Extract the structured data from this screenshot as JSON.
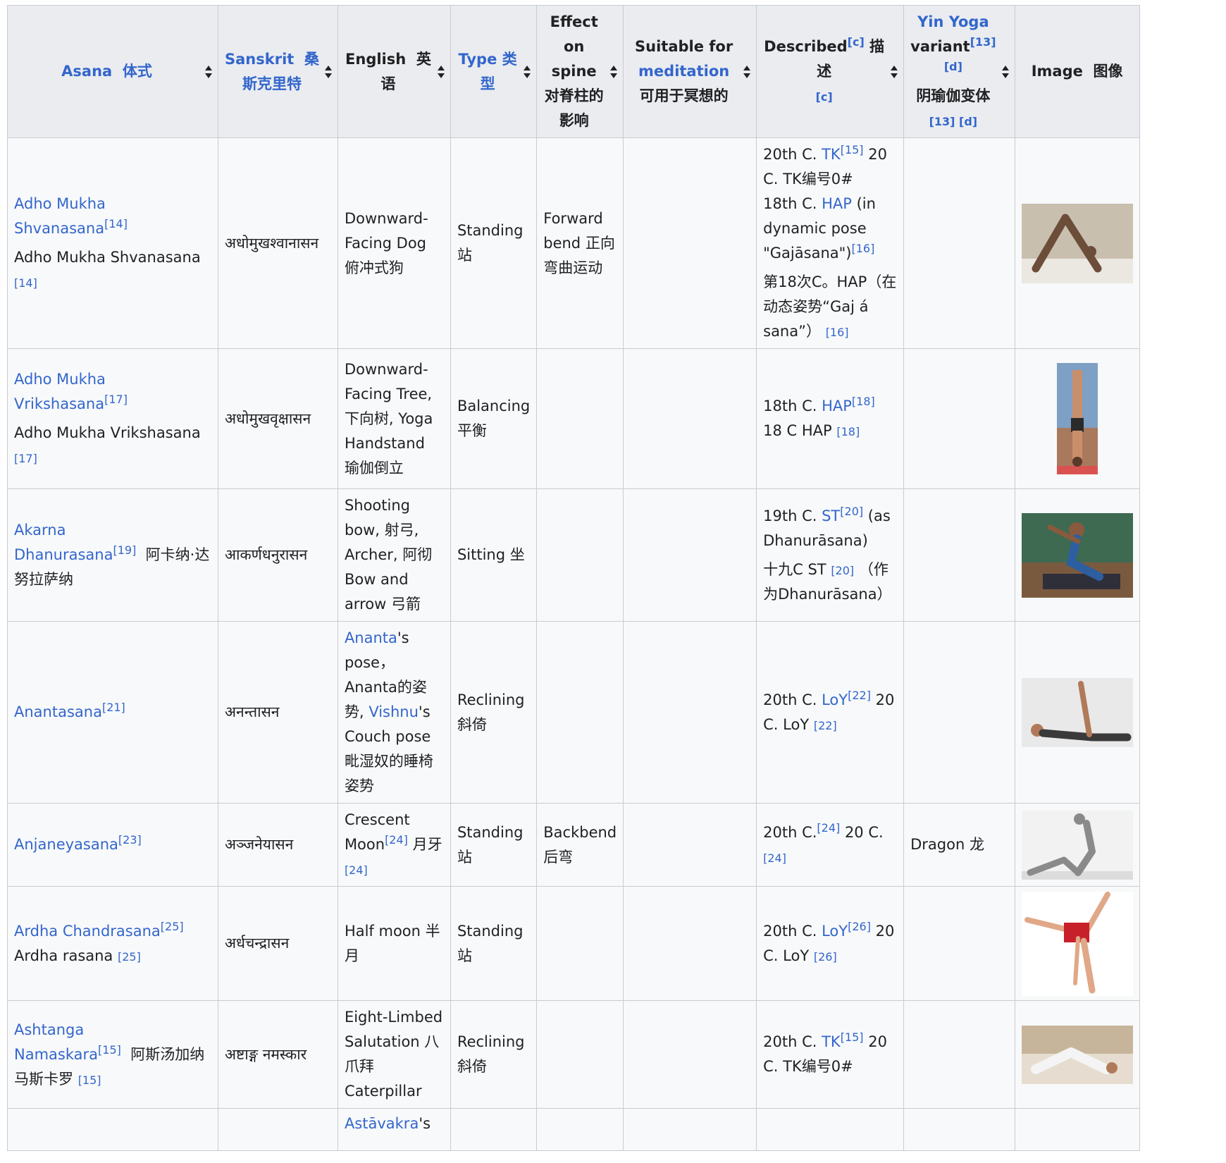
{
  "headers": [
    {
      "label": "Asana",
      "cn": "体式",
      "link": true
    },
    {
      "label": "Sanskrit",
      "cn": "桑斯克里特",
      "link": true
    },
    {
      "label": "English",
      "cn": "英语",
      "link": false
    },
    {
      "label": "Type",
      "cn": "类型",
      "link": true
    },
    {
      "label": "Effect on spine",
      "cn": "对脊柱的影响",
      "link": false
    },
    {
      "pre": "Suitable for",
      "link_text": "meditation",
      "cn": "可用于冥想的"
    },
    {
      "label": "Described",
      "sup": "[c]",
      "cn": "描述",
      "ref": "[c]"
    },
    {
      "link_text": "Yin Yoga",
      "post": "variant",
      "sup": "[13][d]",
      "cn": "阴瑜伽变体",
      "ref": "[13] [d]"
    },
    {
      "label": "Image",
      "cn": "图像"
    }
  ],
  "rows": [
    {
      "asana": {
        "link": "Adho Mukha Shvanasana",
        "sup": "[14]",
        "cn": "",
        "second": "Adho Mukha Shvanasana",
        "second_ref": "[14]"
      },
      "sanskrit": "अधोमुखश्वानासन",
      "english": "Downward-Facing Dog 俯冲式狗",
      "type": "Standing 站",
      "spine": "Forward bend 正向弯曲运动",
      "meditation": "",
      "described": {
        "p1_pre": "20th C.",
        "p1_link": "TK",
        "p1_sup": "[15]",
        "p1_post": "20 C. TK编号0#",
        "p2_pre": "18th C.",
        "p2_link": "HAP",
        "p2_post": "(in dynamic pose \"Gajāsana\")",
        "p2_sup": "[16]",
        "p3": "第18次C。HAP（在动态姿势“Gaj á sana”）",
        "p3_ref": "[16]"
      },
      "yin": "",
      "image": {
        "name": "downward-dog-photo",
        "w": 158,
        "h": 113,
        "bg": "#c9bfae"
      }
    },
    {
      "asana": {
        "link": "Adho Mukha Vrikshasana",
        "sup": "[17]",
        "cn": "",
        "second": "Adho Mukha Vrikshasana",
        "second_ref": "[17]"
      },
      "sanskrit": "अधोमुखवृक्षासन",
      "english": "Downward-Facing Tree, 下向树, Yoga Handstand 瑜伽倒立",
      "type": "Balancing 平衡",
      "spine": "",
      "meditation": "",
      "described": {
        "p1_pre": "18th C.",
        "p1_link": "HAP",
        "p1_sup": "[18]",
        "p1_post": "18 C HAP",
        "p1_ref": "[18]"
      },
      "yin": "",
      "image": {
        "name": "handstand-photo",
        "w": 58,
        "h": 158,
        "bg": "#a9795e"
      }
    },
    {
      "asana": {
        "link": "Akarna Dhanurasana",
        "sup": "[19]",
        "cn": "阿卡纳·达努拉萨纳"
      },
      "sanskrit": "आकर्णधनुरासन",
      "english": "Shooting bow, 射弓, Archer, 阿彻 Bow and arrow 弓箭",
      "type": "Sitting 坐",
      "spine": "",
      "meditation": "",
      "described": {
        "p1_pre": "19th C.",
        "p1_link": "ST",
        "p1_sup": "[20]",
        "p1_post": "(as Dhanurāsana)",
        "p3": "十九C ST",
        "p3_ref": "[20]",
        "p3_post": "（作为Dhanurāsana）"
      },
      "yin": "",
      "image": {
        "name": "archer-pose-photo",
        "w": 158,
        "h": 120,
        "bg": "#5b4a44"
      }
    },
    {
      "asana": {
        "link": "Anantasana",
        "sup": "[21]",
        "cn": ""
      },
      "sanskrit": "अनन्तासन",
      "english": {
        "link1": "Ananta",
        "t1": "'s pose，Ananta的姿势,",
        "link2": "Vishnu",
        "t2": "'s Couch pose 毗湿奴的睡椅姿势"
      },
      "type": "Reclining 斜倚",
      "spine": "",
      "meditation": "",
      "described": {
        "p1_pre": "20th C.",
        "p1_link": "LoY",
        "p1_sup": "[22]",
        "p1_post": "20 C. LoY",
        "p1_ref": "[22]"
      },
      "yin": "",
      "image": {
        "name": "anantasana-photo",
        "w": 158,
        "h": 98,
        "bg": "#e9e9e9"
      }
    },
    {
      "asana": {
        "link": "Anjaneyasana",
        "sup": "[23]",
        "cn": ""
      },
      "sanskrit": "अञ्जनेयासन",
      "english": {
        "text": "Crescent Moon",
        "sup": "[24]",
        "cn": "月牙",
        "ref": "[24]"
      },
      "type": "Standing 站",
      "spine": "Backbend 后弯",
      "meditation": "",
      "described": {
        "p1_pre": "20th C.",
        "p1_sup": "[24]",
        "p1_post": "20 C.",
        "p1_ref": "[24]"
      },
      "yin": "Dragon 龙",
      "image": {
        "name": "crescent-moon-illustration",
        "w": 158,
        "h": 98,
        "bg": "#dcdcdc"
      }
    },
    {
      "asana": {
        "link": "Ardha Chandrasana",
        "sup": "[25]",
        "cn": "",
        "second": "Ardha rasana",
        "second_ref": "[25]"
      },
      "sanskrit": "अर्धचन्द्रासन",
      "english": "Half moon 半月",
      "type": "Standing 站",
      "spine": "",
      "meditation": "",
      "described": {
        "p1_pre": "20th C.",
        "p1_link": "LoY",
        "p1_sup": "[26]",
        "p1_post": "20 C. LoY",
        "p1_ref": "[26]"
      },
      "yin": "",
      "image": {
        "name": "half-moon-photo",
        "w": 158,
        "h": 148,
        "bg": "#f1ecea"
      }
    },
    {
      "asana": {
        "link": "Ashtanga Namaskara",
        "sup": "[15]",
        "cn": "阿斯汤加纳马斯卡罗",
        "cn_ref": "[15]"
      },
      "sanskrit": "अष्टाङ्ग नमस्कार",
      "english": "Eight-Limbed Salutation 八爪拜 Caterpillar",
      "type": "Reclining 斜倚",
      "spine": "",
      "meditation": "",
      "described": {
        "p1_pre": "20th C.",
        "p1_link": "TK",
        "p1_sup": "[15]",
        "p1_post": "20 C. TK编号0#"
      },
      "yin": "",
      "image": {
        "name": "eight-limbed-photo",
        "w": 158,
        "h": 83,
        "bg": "#c7b59b"
      }
    },
    {
      "english_partial": {
        "link": "Astāvakra",
        "t": "'s"
      }
    }
  ]
}
